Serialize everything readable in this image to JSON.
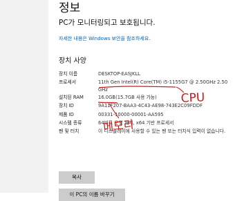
{
  "page": {
    "title": "정보",
    "protection_status": "PC가 모니터링되고 보호됩니다.",
    "security_link": "자세한 내용은 Windows 보안을 참조하세요."
  },
  "device_specs": {
    "heading": "장치 사양",
    "rows": [
      {
        "label": "장치 이름",
        "value": "DESKTOP-EASJKLL"
      },
      {
        "label": "프로세서",
        "value": "11th Gen Intel(R) Core(TM) i5-1155G7 @ 2.50GHz 2.50 GHz"
      },
      {
        "label": "설치된 RAM",
        "value": "16.0GB(15.7GB 사용 가능)"
      },
      {
        "label": "장치 ID",
        "value": "9A11F207-BAA3-4C43-AE98-743E2C09FDDF"
      },
      {
        "label": "제품 ID",
        "value": "00331-10000-00001-AA595"
      },
      {
        "label": "시스템 종류",
        "value": "64비트 운영 체제, x64 기반 프로세서"
      },
      {
        "label": "펜 및 터치",
        "value": "이 디스플레이에 사용할 수 있는 펜 또는 터치식 입력이 없습니다."
      }
    ]
  },
  "buttons": {
    "copy": "복사",
    "rename": "이 PC의 이름 바꾸기"
  },
  "annotations": {
    "cpu_label": "CPU",
    "ram_label": "메모리",
    "ink_color": "#c81e1e"
  }
}
